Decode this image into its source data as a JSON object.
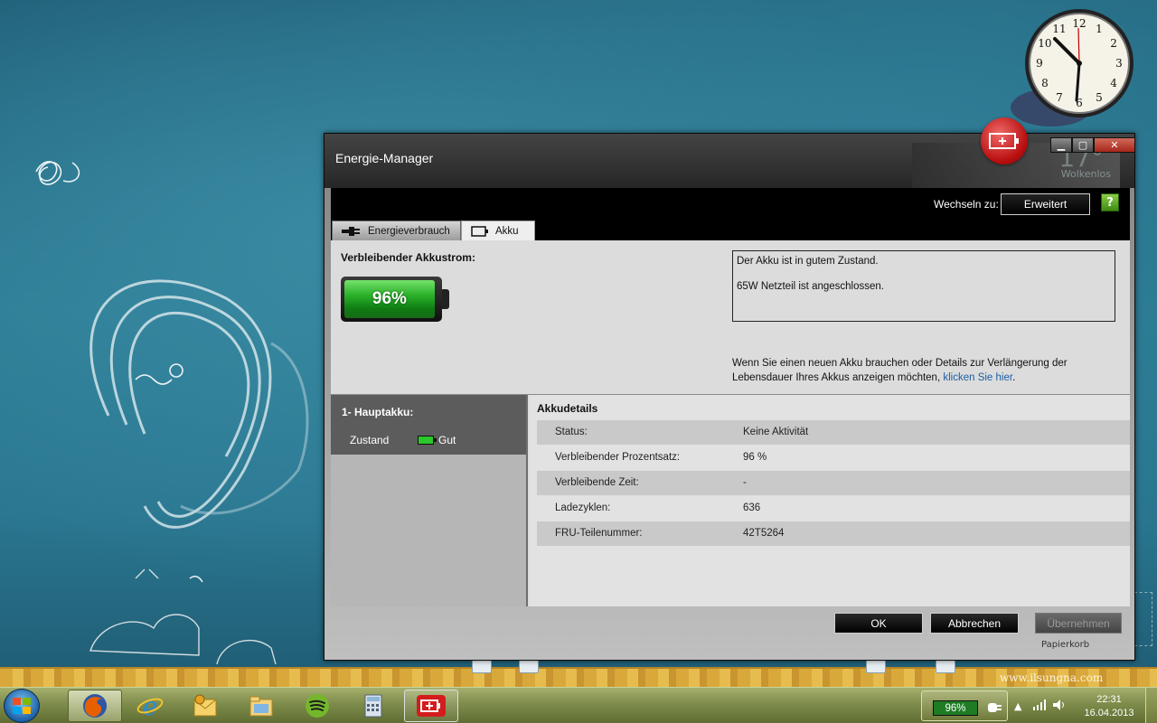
{
  "desktop": {
    "watermark": "www.ilsungna.com",
    "clock": {
      "hours": [
        12,
        1,
        2,
        3,
        4,
        5,
        6,
        7,
        8,
        9,
        10,
        11
      ]
    },
    "gadget_weather_temp": "17°",
    "gadget_weather_text": "Wolkenlos",
    "recycle_bin_label": "Papierkorb",
    "artist_signature": "Il Sung Na"
  },
  "window": {
    "title": "Energie-Manager",
    "switch_label": "Wechseln zu:",
    "switch_button": "Erweitert",
    "help_label": "?",
    "tabs": [
      {
        "label": "Energieverbrauch",
        "icon": "plug-icon"
      },
      {
        "label": "Akku",
        "icon": "battery-icon"
      }
    ],
    "remaining_title": "Verbleibender Akkustrom:",
    "battery_percent": "96%",
    "battery_fraction": 0.96,
    "status_lines": [
      "Der Akku ist in gutem Zustand.",
      "65W Netzteil ist angeschlossen."
    ],
    "info_text": "Wenn Sie einen neuen Akku brauchen oder Details zur Verlängerung der Lebensdauer Ihres Akkus anzeigen möchten,",
    "info_link": "klicken Sie hier",
    "info_end": ".",
    "battery_list": {
      "title": "1- Hauptakku:",
      "status_label": "Zustand",
      "status_value": "Gut"
    },
    "details": {
      "title": "Akkudetails",
      "rows": [
        {
          "key": "Status:",
          "value": "Keine Aktivität"
        },
        {
          "key": "Verbleibender Prozentsatz:",
          "value": "96 %"
        },
        {
          "key": "Verbleibende Zeit:",
          "value": "-"
        },
        {
          "key": "Ladezyklen:",
          "value": "636"
        },
        {
          "key": "FRU-Teilenummer:",
          "value": "42T5264"
        }
      ]
    },
    "buttons": {
      "ok": "OK",
      "cancel": "Abbrechen",
      "apply": "Übernehmen"
    },
    "colors": {
      "battery_green": "#2bb02a",
      "link_blue": "#1b5ea4"
    }
  },
  "taskbar": {
    "apps": [
      "firefox-icon",
      "internet-explorer-icon",
      "mail-icon",
      "file-explorer-icon",
      "spotify-icon",
      "calculator-icon",
      "energy-manager-icon"
    ],
    "battery_percent": "96%",
    "time": "22:31",
    "date": "16.04.2013"
  }
}
